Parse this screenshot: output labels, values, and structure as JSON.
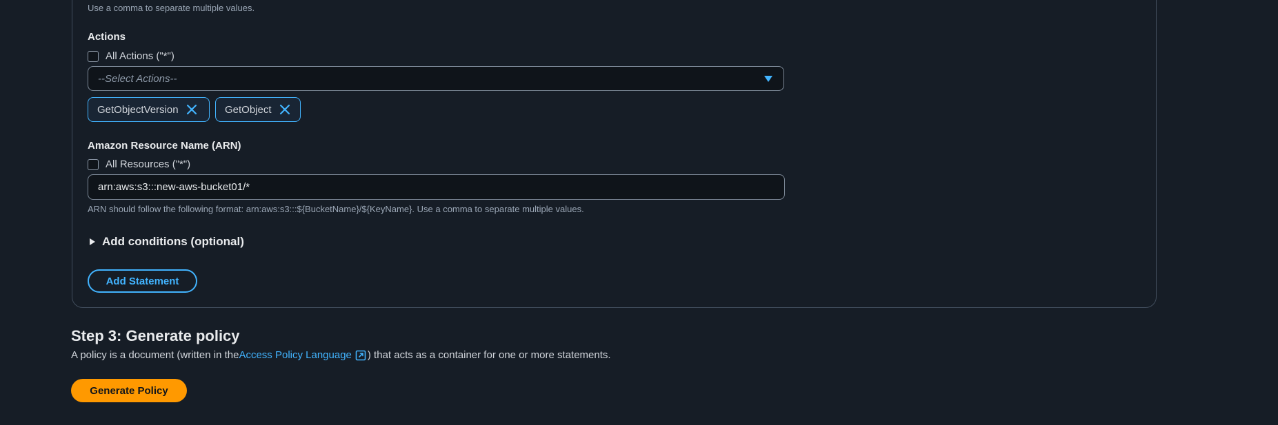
{
  "statement": {
    "top_hint": "Use a comma to separate multiple values.",
    "actions": {
      "label": "Actions",
      "all_checkbox_label": "All Actions (\"*\")",
      "select_placeholder": "--Select Actions--",
      "tokens": [
        "GetObjectVersion",
        "GetObject"
      ]
    },
    "arn": {
      "label": "Amazon Resource Name (ARN)",
      "all_checkbox_label": "All Resources (\"*\")",
      "value": "arn:aws:s3:::new-aws-bucket01/*",
      "hint": "ARN should follow the following format: arn:aws:s3:::${BucketName}/${KeyName}. Use a comma to separate multiple values."
    },
    "conditions_label": "Add conditions (optional)",
    "add_statement_label": "Add Statement"
  },
  "step3": {
    "title": "Step 3: Generate policy",
    "desc_prefix": "A policy is a document (written in the ",
    "link_text": "Access Policy Language",
    "desc_suffix": ") that acts as a container for one or more statements.",
    "button_label": "Generate Policy"
  },
  "colors": {
    "background": "#161d26",
    "accent": "#42b4ff",
    "primary_button": "#ff9900"
  },
  "icons": {
    "dropdown": "caret-down-icon",
    "token_remove": "close-icon",
    "external_link": "external-link-icon",
    "expander": "caret-right-icon"
  }
}
